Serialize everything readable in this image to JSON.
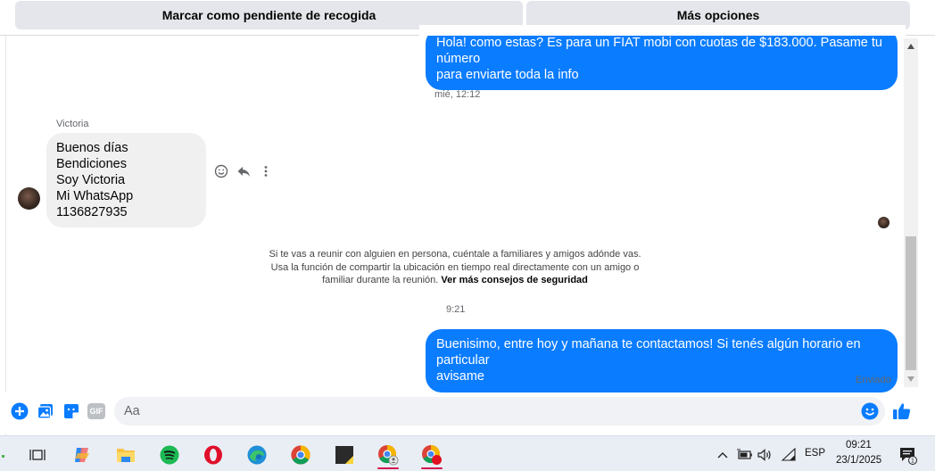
{
  "actions": {
    "mark_pickup_label": "Marcar como pendiente de recogida",
    "more_options_label": "Más opciones"
  },
  "conversation": {
    "outgoing_1": [
      "Hola! como estas? Es para un FIAT mobi con cuotas de $183.000. Pasame tu número",
      "para enviarte toda la info"
    ],
    "timestamp_1": "mié, 12:12",
    "incoming": {
      "sender": "Victoria",
      "lines": [
        "Buenos días",
        "Bendiciones",
        "Soy Victoria",
        "Mi WhatsApp 1136827935"
      ]
    },
    "safety_notice": {
      "text": "Si te vas a reunir con alguien en persona, cuéntale a familiares y amigos adónde vas. Usa la función de compartir la ubicación en tiempo real directamente con un amigo o familiar durante la reunión.",
      "link": "Ver más consejos de seguridad"
    },
    "timestamp_2": "9:21",
    "outgoing_2": [
      "Buenisimo, entre hoy y mañana te contactamos! Si tenés algún horario en particular",
      "avisame"
    ],
    "status": "Enviado"
  },
  "composer": {
    "placeholder": "Aa",
    "icons": [
      "plus-icon",
      "photo-icon",
      "sticker-icon",
      "gif-icon",
      "emoji-icon",
      "like-icon"
    ],
    "gif_label": "GIF"
  },
  "taskbar": {
    "apps": [
      "task-view",
      "copilot",
      "file-explorer",
      "spotify",
      "opera",
      "edge",
      "chrome",
      "sticky-notes",
      "chrome-profile",
      "chrome-recording"
    ],
    "tray": {
      "language": "ESP",
      "time": "09:21",
      "date": "23/1/2025",
      "notifications": "1"
    }
  },
  "colors": {
    "outgoing_bubble": "#0a7cff",
    "incoming_bubble": "#f0f0f0",
    "accent": "#0a7cff",
    "button_bg": "#e4e6eb"
  }
}
